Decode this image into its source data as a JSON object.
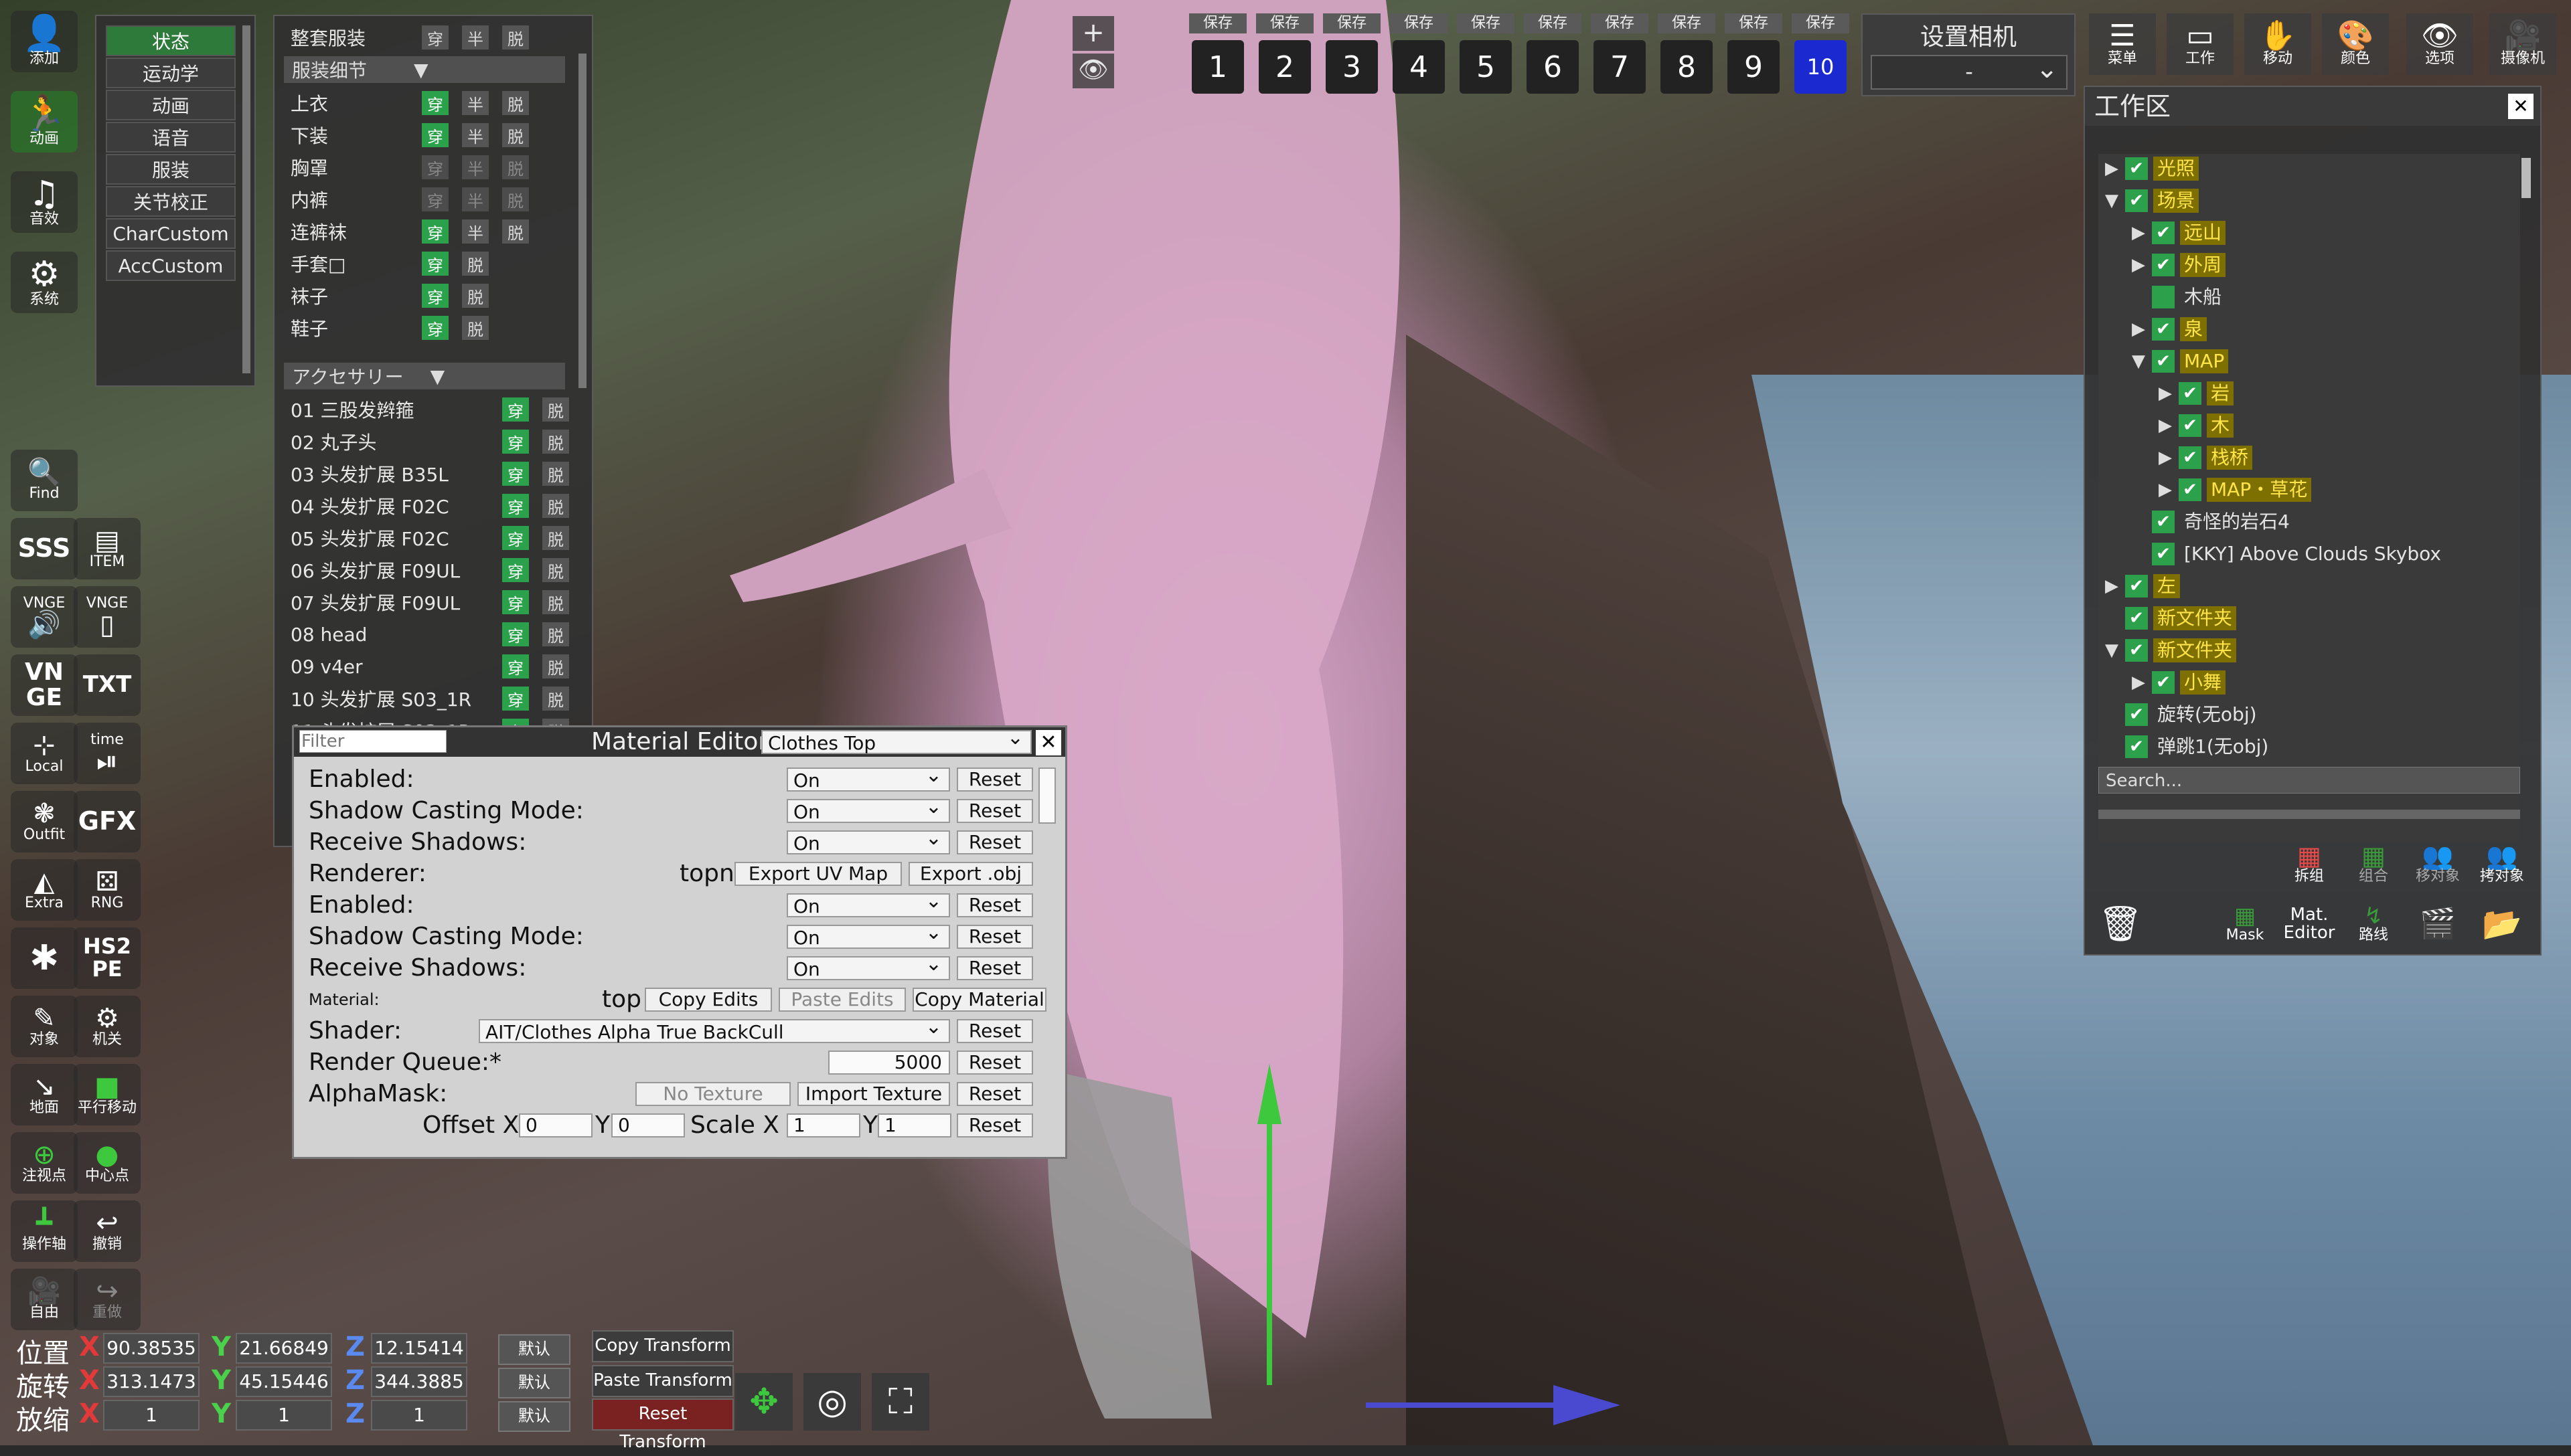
{
  "left_tools": {
    "add": "添加",
    "animation": "动画",
    "sound": "音效",
    "system": "系统",
    "find": "Find",
    "sss": "SSS",
    "item": "ITEM",
    "vnge_audio": "VNGE",
    "vnge_book": "VNGE",
    "vnge": "VN GE",
    "txt": "TXT",
    "local": "Local",
    "time": "time",
    "outfit": "Outfit",
    "gfx": "GFX",
    "extra": "Extra",
    "rng": "RNG",
    "hs2pe": "HS2 PE",
    "object": "对象",
    "mechanism": "机关",
    "ground": "地面",
    "parallel": "平行移动",
    "note_point": "注视点",
    "center": "中心点",
    "operation": "操作轴",
    "undo": "撤销",
    "free": "自由",
    "redo": "重做"
  },
  "state_menu": {
    "items": [
      "状态",
      "运动学",
      "动画",
      "语音",
      "服装",
      "关节校正",
      "CharCustom",
      "AccCustom"
    ],
    "active_index": 0
  },
  "clothes_panel": {
    "full_outfit": {
      "label": "整套服装",
      "buttons": [
        "穿",
        "半",
        "脱"
      ]
    },
    "detail_header": "服装细节",
    "details": [
      {
        "label": "上衣",
        "buttons": [
          "穿",
          "半",
          "脱"
        ],
        "state": "on"
      },
      {
        "label": "下装",
        "buttons": [
          "穿",
          "半",
          "脱"
        ],
        "state": "on"
      },
      {
        "label": "胸罩",
        "buttons": [
          "穿",
          "半",
          "脱"
        ],
        "state": "dim"
      },
      {
        "label": "内裤",
        "buttons": [
          "穿",
          "半",
          "脱"
        ],
        "state": "dim"
      },
      {
        "label": "连裤袜",
        "buttons": [
          "穿",
          "半",
          "脱"
        ],
        "state": "on"
      },
      {
        "label": "手套□",
        "buttons": [
          "穿",
          "脱"
        ],
        "state": "on"
      },
      {
        "label": "袜子",
        "buttons": [
          "穿",
          "脱"
        ],
        "state": "on"
      },
      {
        "label": "鞋子",
        "buttons": [
          "穿",
          "脱"
        ],
        "state": "on"
      }
    ],
    "accessory_header": "アクセサリー",
    "accessories": [
      "01 三股发辫箍",
      "02 丸子头",
      "03 头发扩展 B35L",
      "04 头发扩展 F02C",
      "05 头发扩展 F02C",
      "06 头发扩展 F09UL",
      "07 头发扩展 F09UL",
      "08 head",
      "09 v4er",
      "10 头发扩展 S03_1R",
      "11 头发扩展 S03_1R"
    ],
    "acc_buttons": [
      "穿",
      "脱"
    ]
  },
  "material_editor": {
    "filter_placeholder": "Filter",
    "title": "Material Editor",
    "dropdown": "Clothes Top",
    "close": "✕",
    "rows": {
      "enabled1": {
        "label": "Enabled:",
        "value": "On",
        "reset": "Reset"
      },
      "shadow_cast1": {
        "label": "Shadow Casting Mode:",
        "value": "On",
        "reset": "Reset"
      },
      "receive1": {
        "label": "Receive Shadows:",
        "value": "On",
        "reset": "Reset"
      },
      "renderer": {
        "label": "Renderer:",
        "value": "topn",
        "btn1": "Export UV Map",
        "btn2": "Export .obj"
      },
      "enabled2": {
        "label": "Enabled:",
        "value": "On",
        "reset": "Reset"
      },
      "shadow_cast2": {
        "label": "Shadow Casting Mode:",
        "value": "On",
        "reset": "Reset"
      },
      "receive2": {
        "label": "Receive Shadows:",
        "value": "On",
        "reset": "Reset"
      },
      "material": {
        "label": "Material:",
        "value": "top",
        "copy": "Copy Edits",
        "paste": "Paste Edits",
        "copy_mat": "Copy Material"
      },
      "shader": {
        "label": "Shader:",
        "value": "AIT/Clothes Alpha True BackCull",
        "reset": "Reset"
      },
      "render_queue": {
        "label": "Render Queue:*",
        "value": "5000",
        "reset": "Reset"
      },
      "alphamask": {
        "label": "AlphaMask:",
        "no_texture": "No Texture",
        "import": "Import Texture",
        "reset": "Reset"
      },
      "offset": {
        "offset_label": "Offset X",
        "ox": "0",
        "y_label": "Y",
        "oy": "0",
        "scale_label": "Scale X",
        "sx": "1",
        "sy_label": "Y",
        "sy": "1",
        "reset": "Reset"
      }
    }
  },
  "scene_slots": {
    "save_label": "保存",
    "slots": [
      "1",
      "2",
      "3",
      "4",
      "5",
      "6",
      "7",
      "8",
      "9",
      "10"
    ]
  },
  "camera": {
    "title": "设置相机",
    "value": "-"
  },
  "top_right": {
    "menu": "菜单",
    "work": "工作",
    "move": "移动",
    "color": "颜色",
    "options": "选项",
    "camera": "摄像机"
  },
  "workspace": {
    "title": "工作区",
    "close": "✕",
    "tree": [
      {
        "label": "光照",
        "depth": 0,
        "arrow": "▶",
        "style": "yellow"
      },
      {
        "label": "场景",
        "depth": 0,
        "arrow": "▼",
        "style": "yellow"
      },
      {
        "label": "远山",
        "depth": 1,
        "arrow": "▶",
        "style": "yellow"
      },
      {
        "label": "外周",
        "depth": 1,
        "arrow": "▶",
        "style": "yellow"
      },
      {
        "label": "木船",
        "depth": 1,
        "arrow": "",
        "style": "plain"
      },
      {
        "label": "泉",
        "depth": 1,
        "arrow": "▶",
        "style": "yellow"
      },
      {
        "label": "MAP",
        "depth": 1,
        "arrow": "▼",
        "style": "yellow"
      },
      {
        "label": "岩",
        "depth": 2,
        "arrow": "▶",
        "style": "yellow"
      },
      {
        "label": "木",
        "depth": 2,
        "arrow": "▶",
        "style": "yellow"
      },
      {
        "label": "栈桥",
        "depth": 2,
        "arrow": "▶",
        "style": "yellow"
      },
      {
        "label": "MAP・草花",
        "depth": 2,
        "arrow": "▶",
        "style": "yellow"
      },
      {
        "label": "奇怪的岩石4",
        "depth": 1,
        "arrow": "",
        "style": "plain"
      },
      {
        "label": "[KKY] Above Clouds Skybox",
        "depth": 1,
        "arrow": "",
        "style": "plain"
      },
      {
        "label": "左",
        "depth": 0,
        "arrow": "▶",
        "style": "yellow"
      },
      {
        "label": "新文件夹",
        "depth": 0,
        "arrow": "",
        "style": "yellow"
      },
      {
        "label": "新文件夹",
        "depth": 0,
        "arrow": "▼",
        "style": "yellow"
      },
      {
        "label": "小舞",
        "depth": 1,
        "arrow": "▶",
        "style": "yellow"
      },
      {
        "label": "旋转(无obj)",
        "depth": 0,
        "arrow": "",
        "style": "plain"
      },
      {
        "label": "弹跳1(无obj)",
        "depth": 0,
        "arrow": "",
        "style": "plain"
      }
    ],
    "search_placeholder": "Search...",
    "buttons": {
      "split": "拆组",
      "group": "组合",
      "parent": "移对象",
      "copy_obj": "拷对象",
      "mask": "Mask",
      "mat_editor": "Mat. Editor",
      "path": "路线"
    }
  },
  "transform": {
    "position_label": "位置",
    "rotation_label": "旋转",
    "scale_label": "放缩",
    "pos": {
      "x": "90.38535",
      "y": "21.66849",
      "z": "12.15414"
    },
    "rot": {
      "x": "313.1473",
      "y": "45.15446",
      "z": "344.3885"
    },
    "scale": {
      "x": "1",
      "y": "1",
      "z": "1"
    },
    "default": "默认",
    "copy": "Copy Transform",
    "paste": "Paste Transform",
    "reset": "Reset Transform",
    "axis_x": "X",
    "axis_y": "Y",
    "axis_z": "Z"
  }
}
